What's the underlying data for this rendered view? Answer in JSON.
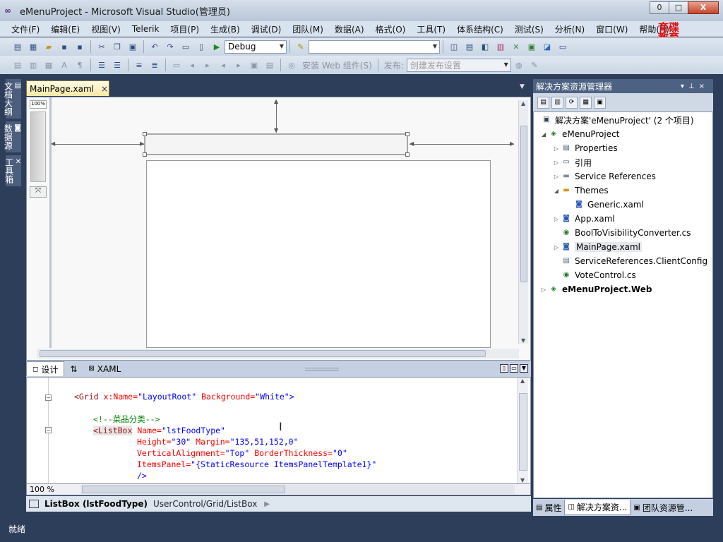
{
  "window": {
    "title": "eMenuProject - Microsoft Visual Studio(管理员)",
    "buttons": [
      "0",
      "□",
      "X"
    ]
  },
  "menu": [
    "文件(F)",
    "编辑(E)",
    "视图(V)",
    "Telerik",
    "项目(P)",
    "生成(B)",
    "调试(D)",
    "团队(M)",
    "数据(A)",
    "格式(O)",
    "工具(T)",
    "体系结构(C)",
    "测试(S)",
    "分析(N)",
    "窗口(W)",
    "帮助(H)"
  ],
  "logo": {
    "line1": "育碟",
    "line2": "教育"
  },
  "toolbar": {
    "config": "Debug",
    "search_value": "",
    "install_web": "安装 Web 组件(S)",
    "publish_label": "发布:",
    "publish_combo": "创建发布设置"
  },
  "left_dock": [
    "文档大纲",
    "数据源",
    "工具箱"
  ],
  "document_tab": {
    "label": "MainPage.xaml",
    "close": "×"
  },
  "designer": {
    "zoom_label": "100%"
  },
  "view_tabs": {
    "design": "设计",
    "swap": "⇅",
    "xaml": "XAML"
  },
  "code_lines": {
    "line1_tag": "<Grid",
    "line1_attr1": "x:Name=",
    "line1_val1": "\"LayoutRoot\"",
    "line1_attr2": "Background=",
    "line1_val2": "\"White\"",
    "line1_end": ">",
    "comment": "<!--菜品分类-->",
    "line3_tag": "<ListBox",
    "line3_attr": "Name=",
    "line3_val": "\"lstFoodType\"",
    "line4_attr1": "Height=",
    "line4_val1": "\"30\"",
    "line4_attr2": "Margin=",
    "line4_val2": "\"135,51,152,0\"",
    "line5_attr1": "VerticalAlignment=",
    "line5_val1": "\"Top\"",
    "line5_attr2": "BorderThickness=",
    "line5_val2": "\"0\"",
    "line6_attr": "ItemsPanel=",
    "line6_val": "\"{StaticResource ItemsPanelTemplate1}\"",
    "line7": "/>"
  },
  "editor_zoom": "100 %",
  "breadcrumb": {
    "element": "ListBox (lstFoodType)",
    "path": "UserControl/Grid/ListBox"
  },
  "solution_explorer": {
    "title": "解决方案资源管理器",
    "solution": "解决方案'eMenuProject' (2 个项目)",
    "project": "eMenuProject",
    "items": [
      "Properties",
      "引用",
      "Service References",
      "Themes",
      "Generic.xaml",
      "App.xaml",
      "BoolToVisibilityConverter.cs",
      "MainPage.xaml",
      "ServiceReferences.ClientConfig",
      "VoteControl.cs"
    ],
    "web_project": "eMenuProject.Web"
  },
  "bottom_tabs": [
    "属性",
    "解决方案资...",
    "团队资源管..."
  ],
  "status": "就绪"
}
